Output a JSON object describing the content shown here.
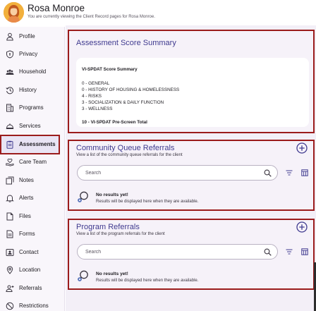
{
  "client": {
    "name": "Rosa Monroe",
    "subtitle": "You are currently viewing the Client Record pages for Rosa Monroe."
  },
  "sidebar": {
    "items": [
      {
        "label": "Profile",
        "icon": "person-icon"
      },
      {
        "label": "Privacy",
        "icon": "shield-icon"
      },
      {
        "label": "Household",
        "icon": "group-icon"
      },
      {
        "label": "History",
        "icon": "history-icon"
      },
      {
        "label": "Programs",
        "icon": "building-icon"
      },
      {
        "label": "Services",
        "icon": "concierge-bell-icon"
      },
      {
        "label": "Assessments",
        "icon": "clipboard-icon"
      },
      {
        "label": "Care Team",
        "icon": "care-team-icon"
      },
      {
        "label": "Notes",
        "icon": "notes-icon"
      },
      {
        "label": "Alerts",
        "icon": "bell-icon"
      },
      {
        "label": "Files",
        "icon": "file-icon"
      },
      {
        "label": "Forms",
        "icon": "form-icon"
      },
      {
        "label": "Contact",
        "icon": "contact-card-icon"
      },
      {
        "label": "Location",
        "icon": "location-pin-icon"
      },
      {
        "label": "Referrals",
        "icon": "person-add-icon"
      },
      {
        "label": "Restrictions",
        "icon": "restriction-icon"
      }
    ],
    "active": "Assessments"
  },
  "assessment": {
    "title": "Assessment Score Summary",
    "heading": "VI-SPDAT Score Summary",
    "lines": [
      "0 - GENERAL",
      "0 - HISTORY OF HOUSING & HOMELESSNESS",
      "4 - RISKS",
      "3 - SOCIALIZATION & DAILY FUNCTION",
      "3 - WELLNESS"
    ],
    "total": "10 - VI-SPDAT Pre-Screen Total"
  },
  "community": {
    "title": "Community Queue Referrals",
    "description": "View a list of the community queue referrals for the client",
    "search_placeholder": "Search",
    "empty_title": "No results yet!",
    "empty_sub": "Results will be displayed here when they are available."
  },
  "program": {
    "title": "Program Referrals",
    "description": "View a list of the program referrals for the client",
    "search_placeholder": "Search",
    "empty_title": "No results yet!",
    "empty_sub": "Results will be displayed here when they are available."
  },
  "colors": {
    "accent": "#3f3a8f",
    "highlight_border": "#9b1c1c",
    "active_bg": "#e9e4f4"
  }
}
